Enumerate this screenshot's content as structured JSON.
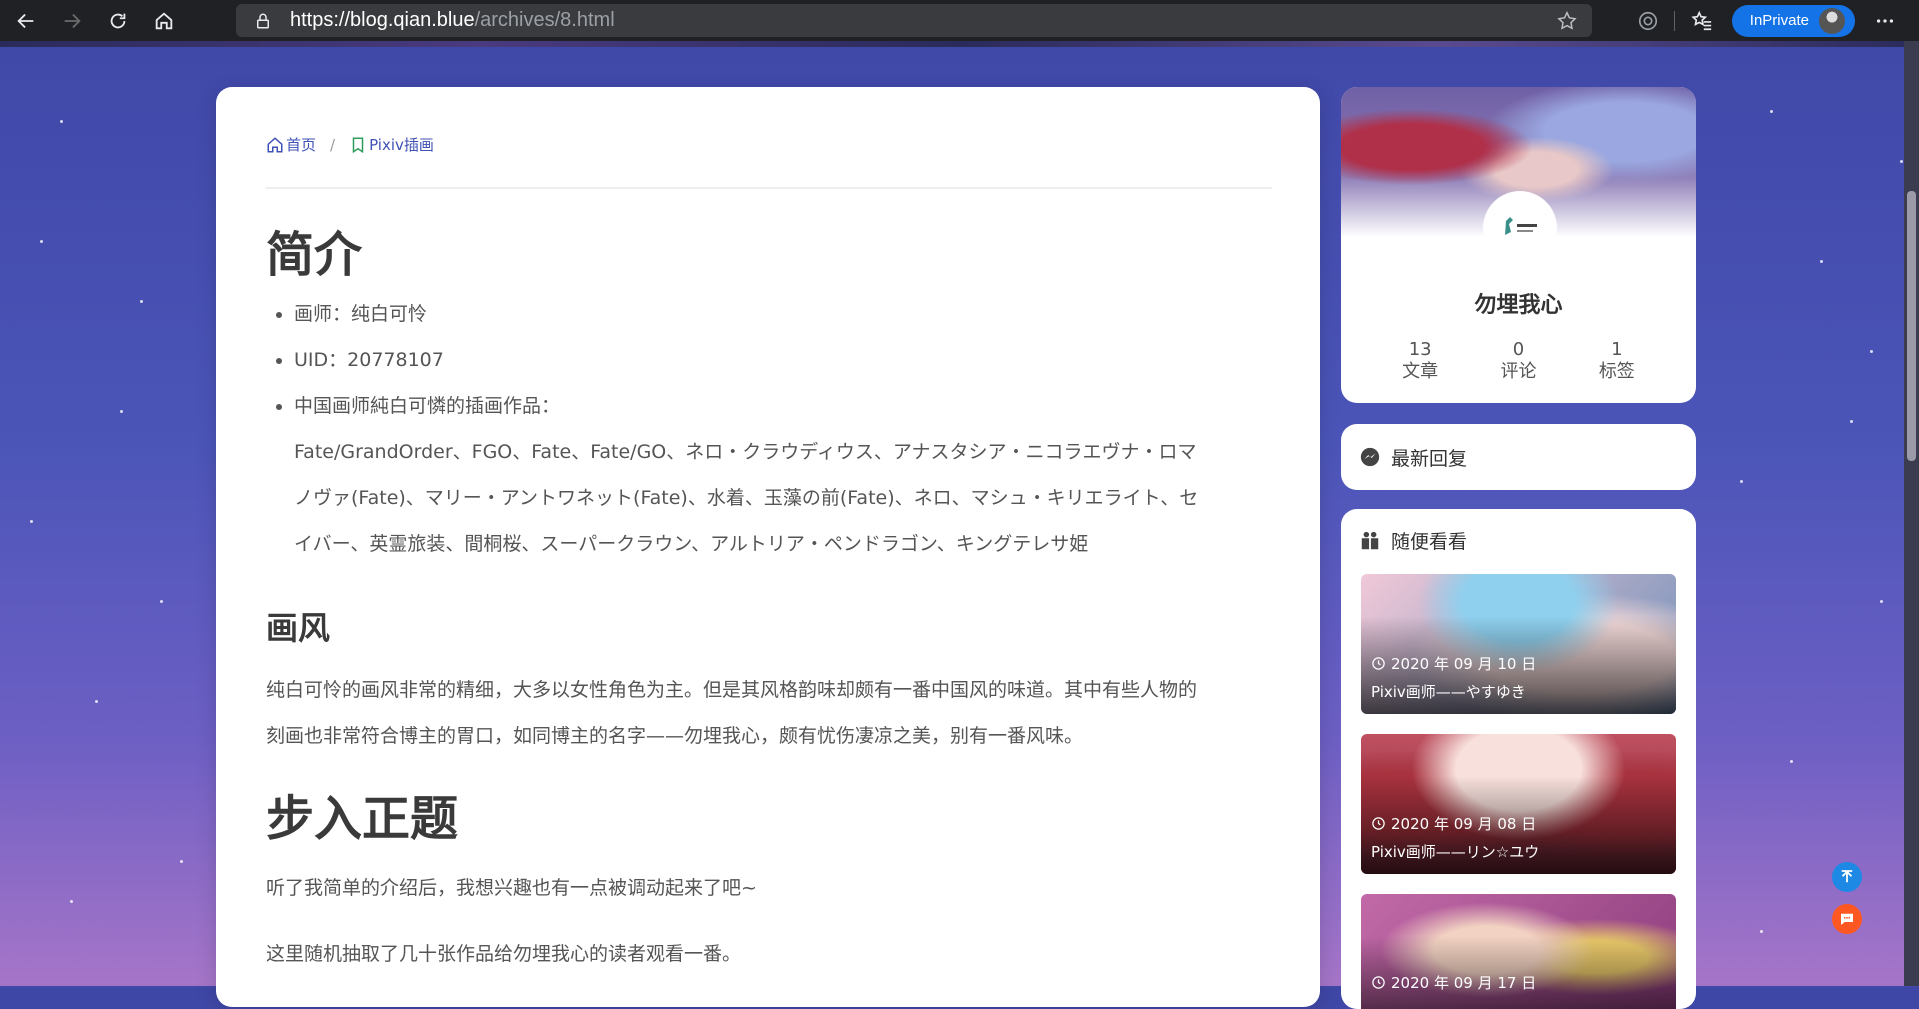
{
  "browser": {
    "url_host": "https://blog.qian.blue",
    "url_path": "/archives/8.html",
    "inprivate_label": "InPrivate"
  },
  "breadcrumb": {
    "home": "首页",
    "category": "Pixiv插画",
    "separator": "/"
  },
  "article": {
    "h_intro": "简介",
    "intro_items": [
      "画师：纯白可怜",
      "UID：20778107",
      "中国画师純白可憐的插画作品：",
      "Fate/GrandOrder、FGO、Fate、Fate/GO、ネロ・クラウディウス、アナスタシア・ニコラエヴナ・ロマ",
      "ノヴァ(Fate)、マリー・アントワネット(Fate)、水着、玉藻の前(Fate)、ネロ、マシュ・キリエライト、セ",
      "イバー、英霊旅装、間桐桜、スーパークラウン、アルトリア・ペンドラゴン、キングテレサ姫"
    ],
    "h_style": "画风",
    "style_p1": "纯白可怜的画风非常的精细，大多以女性角色为主。但是其风格韵味却颇有一番中国风的味道。其中有些人物的",
    "style_p2": "刻画也非常符合博主的胃口，如同博主的名字——勿埋我心，颇有忧伤凄凉之美，别有一番风味。",
    "h_main": "步入正题",
    "main_p1": "听了我简单的介绍后，我想兴趣也有一点被调动起来了吧~",
    "main_p2": "这里随机抽取了几十张作品给勿埋我心的读者观看一番。"
  },
  "profile": {
    "name": "勿埋我心",
    "stats": [
      {
        "value": "13",
        "label": "文章"
      },
      {
        "value": "0",
        "label": "评论"
      },
      {
        "value": "1",
        "label": "标签"
      }
    ]
  },
  "recent_replies": {
    "title": "最新回复"
  },
  "random": {
    "title": "随便看看",
    "posts": [
      {
        "date": "2020 年 09 月 10 日",
        "title": "Pixiv画师——やすゆき",
        "color": "#6f8fb8"
      },
      {
        "date": "2020 年 09 月 08 日",
        "title": "Pixiv画师——リン☆ユウ",
        "color": "#a04a5a"
      },
      {
        "date": "2020 年 09 月 17 日",
        "title": "",
        "color": "#a05a9a"
      }
    ]
  },
  "colors": {
    "accent": "#3f51b5",
    "inprivate": "#1473e6",
    "fab_top": "#1e88e5",
    "fab_chat": "#ff5722"
  }
}
